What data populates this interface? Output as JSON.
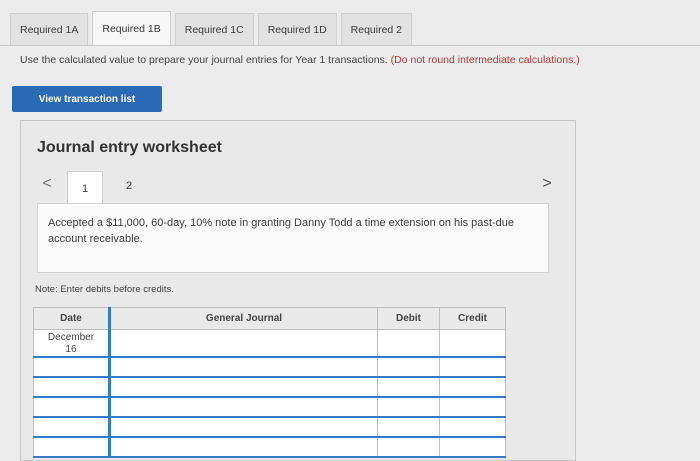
{
  "tabs": [
    "Required 1A",
    "Required 1B",
    "Required 1C",
    "Required 1D",
    "Required 2"
  ],
  "active_tab": 1,
  "instructions": {
    "main": "Use the calculated value to prepare your journal entries for Year 1 transactions. ",
    "hint": "(Do not round intermediate calculations.)"
  },
  "view_button": "View transaction list",
  "worksheet": {
    "title": "Journal entry worksheet",
    "prev_icon": "<",
    "next_icon": ">",
    "pages": [
      "1",
      "2"
    ],
    "transaction": "Accepted a $11,000, 60-day, 10% note in granting Danny Todd a time extension on his past-due account receivable.",
    "note": "Note: Enter debits before credits.",
    "columns": [
      "Date",
      "General Journal",
      "Debit",
      "Credit"
    ],
    "date_month": "December",
    "date_day": "16",
    "rows": 6
  }
}
